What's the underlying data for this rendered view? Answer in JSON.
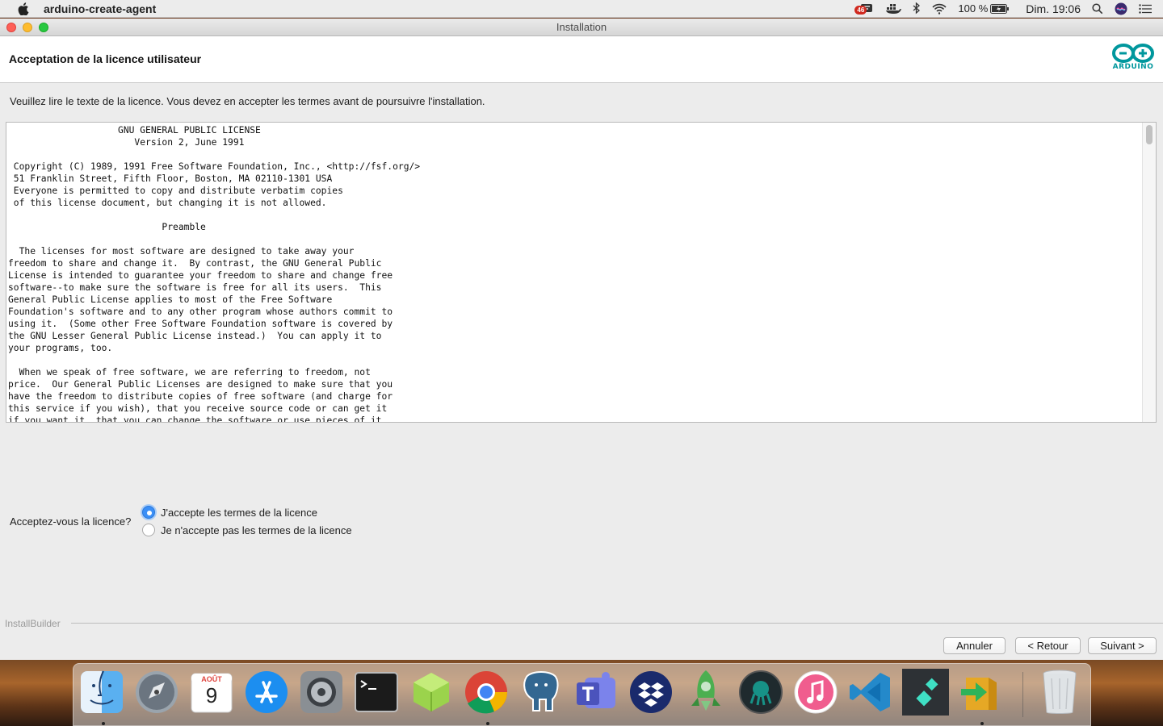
{
  "menubar": {
    "app_name": "arduino-create-agent",
    "notification_count": "46",
    "battery": "100 %",
    "clock": "Dim. 19:06"
  },
  "window": {
    "title": "Installation",
    "header_title": "Acceptation de la licence utilisateur",
    "logo_text": "ARDUINO",
    "instructions": "Veuillez lire le texte de la licence. Vous devez en accepter les termes avant de poursuivre l'installation.",
    "license_text": "                    GNU GENERAL PUBLIC LICENSE\n                       Version 2, June 1991\n\n Copyright (C) 1989, 1991 Free Software Foundation, Inc., <http://fsf.org/>\n 51 Franklin Street, Fifth Floor, Boston, MA 02110-1301 USA\n Everyone is permitted to copy and distribute verbatim copies\n of this license document, but changing it is not allowed.\n\n                            Preamble\n\n  The licenses for most software are designed to take away your\nfreedom to share and change it.  By contrast, the GNU General Public\nLicense is intended to guarantee your freedom to share and change free\nsoftware--to make sure the software is free for all its users.  This\nGeneral Public License applies to most of the Free Software\nFoundation's software and to any other program whose authors commit to\nusing it.  (Some other Free Software Foundation software is covered by\nthe GNU Lesser General Public License instead.)  You can apply it to\nyour programs, too.\n\n  When we speak of free software, we are referring to freedom, not\nprice.  Our General Public Licenses are designed to make sure that you\nhave the freedom to distribute copies of free software (and charge for\nthis service if you wish), that you receive source code or can get it\nif you want it, that you can change the software or use pieces of it",
    "question": "Acceptez-vous la licence?",
    "options": [
      {
        "label": "J'accepte les termes de la licence",
        "selected": true
      },
      {
        "label": "Je n'accepte pas les termes de la licence",
        "selected": false
      }
    ],
    "footer_brand": "InstallBuilder",
    "buttons": {
      "cancel": "Annuler",
      "back": "< Retour",
      "next": "Suivant >"
    }
  },
  "dock": {
    "calendar_month": "AOÛT",
    "calendar_day": "9",
    "items": [
      "finder-icon",
      "launchpad-icon",
      "calendar-icon",
      "app-store-icon",
      "system-preferences-icon",
      "terminal-icon",
      "cube-app-icon",
      "chrome-icon",
      "postgres-elephant-icon",
      "teams-icon",
      "dropbox-icon",
      "rocket-app-icon",
      "gitkraken-icon",
      "music-icon",
      "vscode-icon",
      "filmora-icon",
      "migration-box-icon",
      "trash-icon"
    ]
  },
  "colors": {
    "accent_blue": "#3b8ff6",
    "arduino_teal": "#00979d"
  }
}
